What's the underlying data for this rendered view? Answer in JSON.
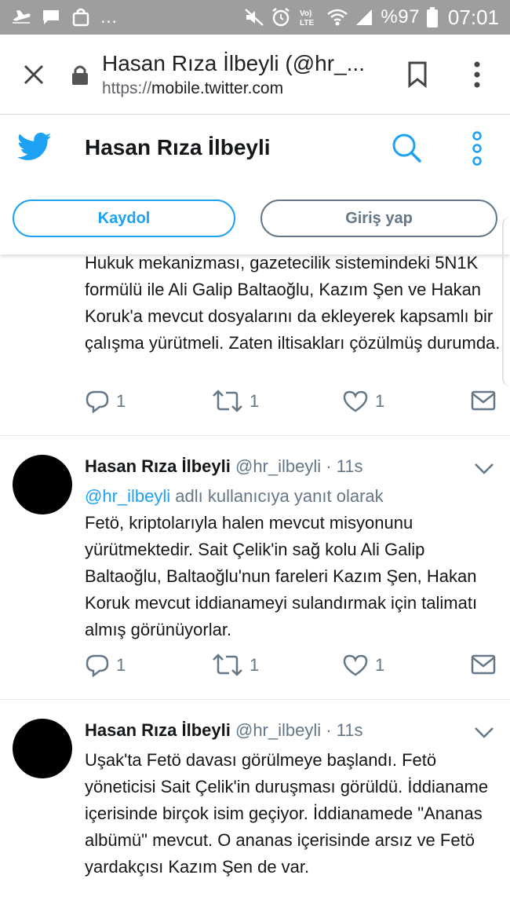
{
  "status_bar": {
    "left_more": "...",
    "battery_text": "%97",
    "time": "07:01",
    "network_label": "LTE"
  },
  "browser": {
    "page_title": "Hasan Rıza İlbeyli (@hr_...",
    "url_scheme": "https://",
    "url_host": "mobile.twitter.com"
  },
  "twitter_header": {
    "title": "Hasan Rıza İlbeyli",
    "signup_label": "Kaydol",
    "login_label": "Giriş yap",
    "brand_color": "#1da1f2"
  },
  "tweets": [
    {
      "text": "Hukuk mekanizması, gazetecilik sistemindeki 5N1K formülü ile Ali Galip Baltaoğlu, Kazım Şen ve Hakan Koruk'a mevcut dosyalarını da ekleyerek kapsamlı bir çalışma yürütmeli. Zaten iltisakları çözülmüş durumda.",
      "reply_count": "1",
      "retweet_count": "1",
      "like_count": "1"
    },
    {
      "name": "Hasan Rıza İlbeyli",
      "handle": "@hr_ilbeyli",
      "time": "· 11s",
      "reply_mention": "@hr_ilbeyli",
      "reply_text": " adlı kullanıcıya yanıt olarak",
      "text": "Fetö, kriptolarıyla halen mevcut misyonunu yürütmektedir. Sait Çelik'in sağ kolu Ali Galip Baltaoğlu, Baltaoğlu'nun fareleri Kazım Şen, Hakan Koruk mevcut iddianameyi sulandırmak için talimatı almış görünüyorlar.",
      "reply_count": "1",
      "retweet_count": "1",
      "like_count": "1"
    },
    {
      "name": "Hasan Rıza İlbeyli",
      "handle": "@hr_ilbeyli",
      "time": "· 11s",
      "text": "Uşak'ta Fetö davası görülmeye başlandı. Fetö yöneticisi Sait Çelik'in duruşması görüldü. İddianame içerisinde birçok isim geçiyor. İddianamede \"Ananas albümü\" mevcut. O ananas içerisinde arsız ve Fetö yardakçısı Kazım Şen de var."
    }
  ]
}
